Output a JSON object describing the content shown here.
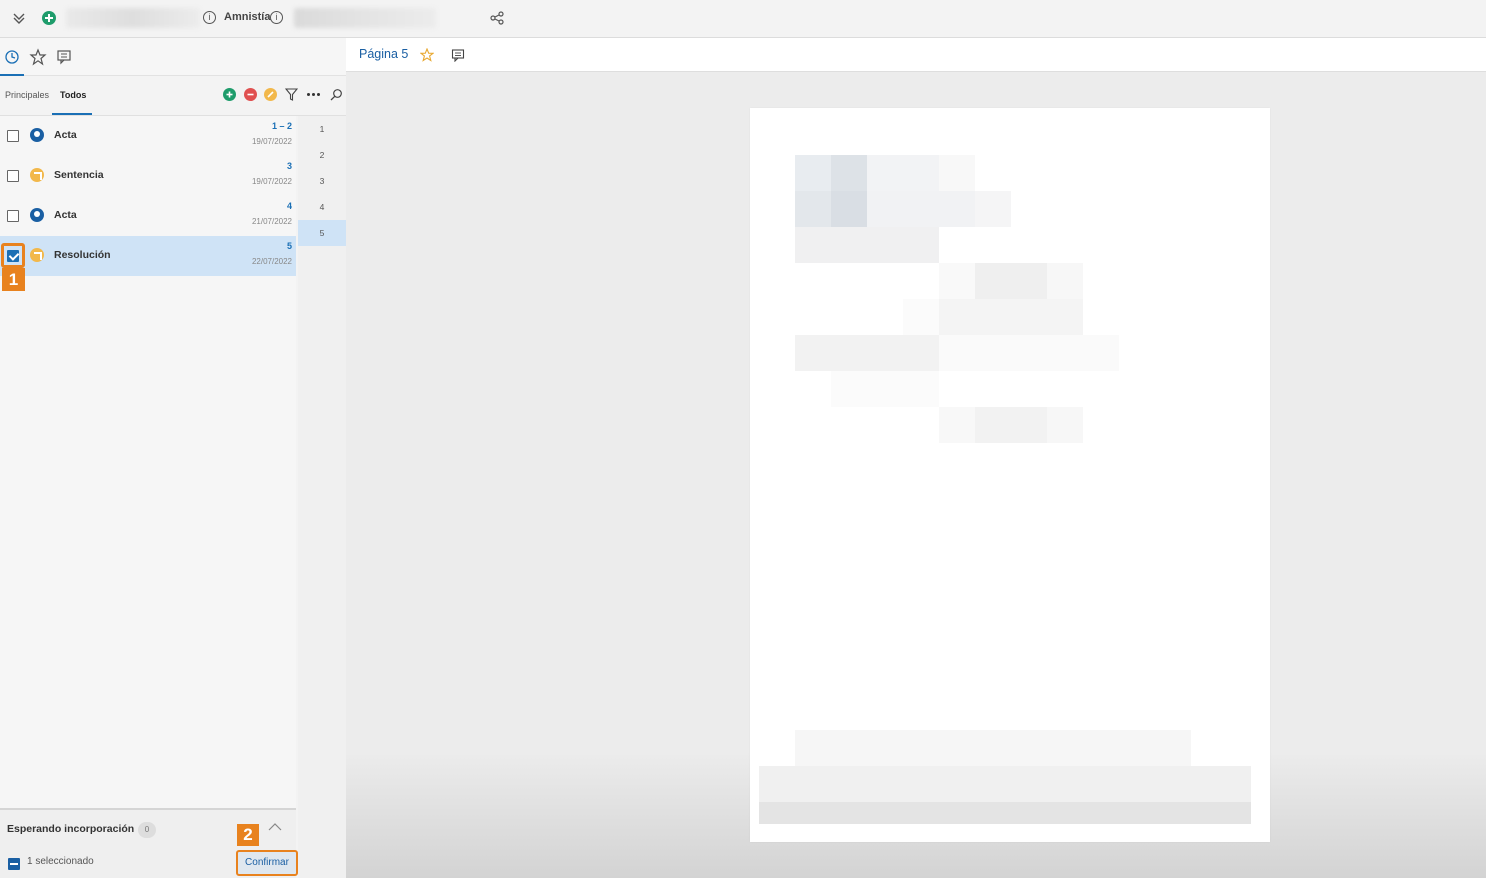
{
  "topbar": {
    "title": "Amnistía",
    "icons": [
      "chevron-down-icon",
      "add-circle-icon",
      "info-icon",
      "share-nodes-icon"
    ]
  },
  "left_panel": {
    "icon_tabs": [
      "clock-icon",
      "star-icon",
      "comment-icon"
    ],
    "tabs": [
      {
        "label": "Principales"
      },
      {
        "label": "Todos"
      }
    ],
    "toolbar_icons": [
      "add-circle-icon",
      "remove-circle-icon",
      "edit-circle-icon",
      "filter-icon",
      "more-icon",
      "search-icon"
    ],
    "documents": [
      {
        "label": "Acta",
        "pages": "1 – 2",
        "date": "19/07/2022",
        "checked": false,
        "icon": "blue"
      },
      {
        "label": "Sentencia",
        "pages": "3",
        "date": "19/07/2022",
        "checked": false,
        "icon": "orange"
      },
      {
        "label": "Acta",
        "pages": "4",
        "date": "21/07/2022",
        "checked": false,
        "icon": "blue"
      },
      {
        "label": "Resolución",
        "pages": "5",
        "date": "22/07/2022",
        "checked": true,
        "icon": "orange"
      }
    ],
    "page_numbers": [
      "1",
      "2",
      "3",
      "4",
      "5"
    ],
    "selected_page": "5",
    "markers": [
      "1",
      "2"
    ],
    "bottom": {
      "title": "Esperando incorporación",
      "count": "0",
      "selected_text": "1 seleccionado",
      "confirm_label": "Confirmar"
    }
  },
  "main": {
    "page_title": "Página 5"
  },
  "colors": {
    "accent": "#1a6fb5",
    "marker": "#e8821e",
    "selection": "#cfe3f6"
  }
}
